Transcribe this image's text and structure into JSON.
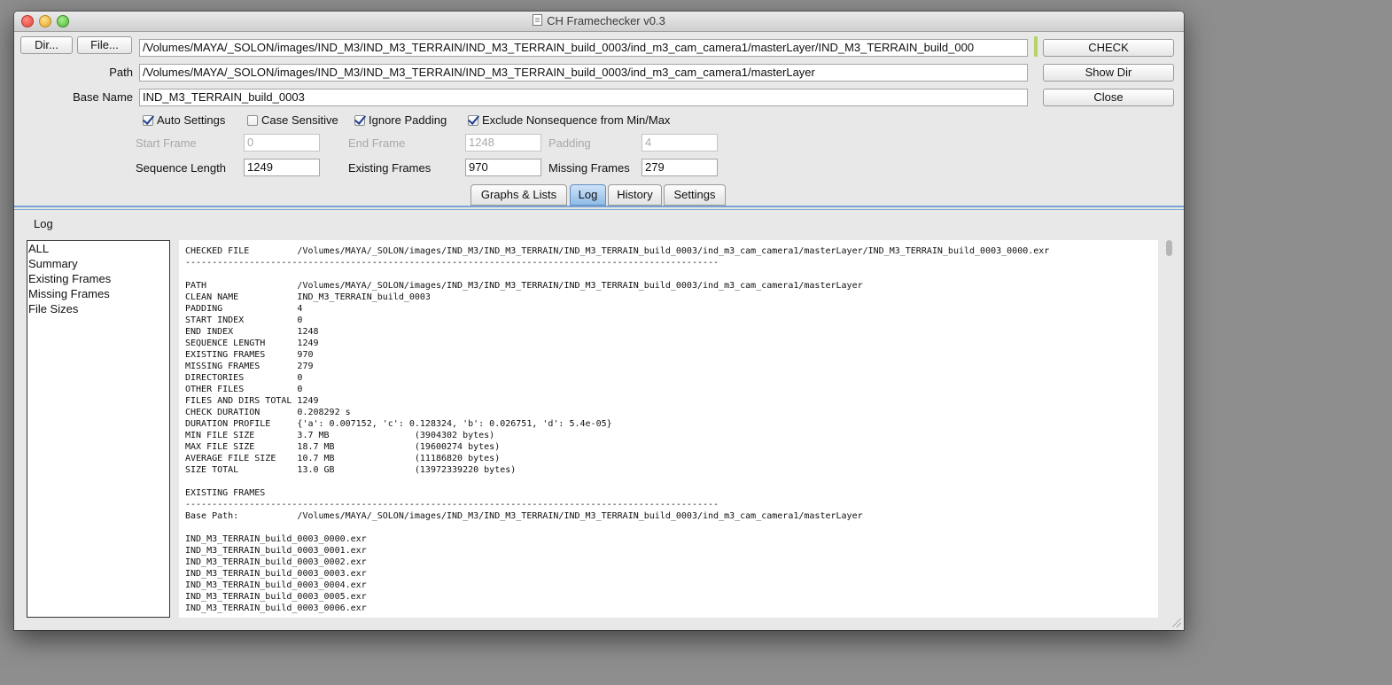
{
  "window": {
    "title": "CH Framechecker v0.3"
  },
  "toolbar": {
    "dir_button": "Dir...",
    "file_button": "File...",
    "file_path": "/Volumes/MAYA/_SOLON/images/IND_M3/IND_M3_TERRAIN/IND_M3_TERRAIN_build_0003/ind_m3_cam_camera1/masterLayer/IND_M3_TERRAIN_build_000",
    "check_button": "CHECK",
    "show_dir_button": "Show Dir",
    "close_button": "Close"
  },
  "path": {
    "label": "Path",
    "value": "/Volumes/MAYA/_SOLON/images/IND_M3/IND_M3_TERRAIN/IND_M3_TERRAIN_build_0003/ind_m3_cam_camera1/masterLayer"
  },
  "basename": {
    "label": "Base Name",
    "value": "IND_M3_TERRAIN_build_0003"
  },
  "options": {
    "auto_settings": {
      "label": "Auto Settings",
      "checked": true
    },
    "case_sensitive": {
      "label": "Case Sensitive",
      "checked": false
    },
    "ignore_padding": {
      "label": "Ignore Padding",
      "checked": true
    },
    "exclude_nonsequence": {
      "label": "Exclude Nonsequence from Min/Max",
      "checked": true
    }
  },
  "frames": {
    "start_label": "Start Frame",
    "start_value": "0",
    "end_label": "End Frame",
    "end_value": "1248",
    "padding_label": "Padding",
    "padding_value": "4",
    "seq_len_label": "Sequence Length",
    "seq_len_value": "1249",
    "existing_label": "Existing Frames",
    "existing_value": "970",
    "missing_label": "Missing Frames",
    "missing_value": "279"
  },
  "tabs": [
    {
      "label": "Graphs & Lists",
      "active": false
    },
    {
      "label": "Log",
      "active": true
    },
    {
      "label": "History",
      "active": false
    },
    {
      "label": "Settings",
      "active": false
    }
  ],
  "log": {
    "title": "Log",
    "categories": [
      "ALL",
      "Summary",
      "Existing Frames",
      "Missing Frames",
      "File Sizes"
    ],
    "text": "CHECKED FILE         /Volumes/MAYA/_SOLON/images/IND_M3/IND_M3_TERRAIN/IND_M3_TERRAIN_build_0003/ind_m3_cam_camera1/masterLayer/IND_M3_TERRAIN_build_0003_0000.exr\n----------------------------------------------------------------------------------------------------\n\nPATH                 /Volumes/MAYA/_SOLON/images/IND_M3/IND_M3_TERRAIN/IND_M3_TERRAIN_build_0003/ind_m3_cam_camera1/masterLayer\nCLEAN NAME           IND_M3_TERRAIN_build_0003\nPADDING              4\nSTART INDEX          0\nEND INDEX            1248\nSEQUENCE LENGTH      1249\nEXISTING FRAMES      970\nMISSING FRAMES       279\nDIRECTORIES          0\nOTHER FILES          0\nFILES AND DIRS TOTAL 1249\nCHECK DURATION       0.208292 s\nDURATION PROFILE     {'a': 0.007152, 'c': 0.128324, 'b': 0.026751, 'd': 5.4e-05}\nMIN FILE SIZE        3.7 MB                (3904302 bytes)\nMAX FILE SIZE        18.7 MB               (19600274 bytes)\nAVERAGE FILE SIZE    10.7 MB               (11186820 bytes)\nSIZE TOTAL           13.0 GB               (13972339220 bytes)\n\nEXISTING FRAMES\n----------------------------------------------------------------------------------------------------\nBase Path:           /Volumes/MAYA/_SOLON/images/IND_M3/IND_M3_TERRAIN/IND_M3_TERRAIN_build_0003/ind_m3_cam_camera1/masterLayer\n\nIND_M3_TERRAIN_build_0003_0000.exr\nIND_M3_TERRAIN_build_0003_0001.exr\nIND_M3_TERRAIN_build_0003_0002.exr\nIND_M3_TERRAIN_build_0003_0003.exr\nIND_M3_TERRAIN_build_0003_0004.exr\nIND_M3_TERRAIN_build_0003_0005.exr\nIND_M3_TERRAIN_build_0003_0006.exr"
  }
}
